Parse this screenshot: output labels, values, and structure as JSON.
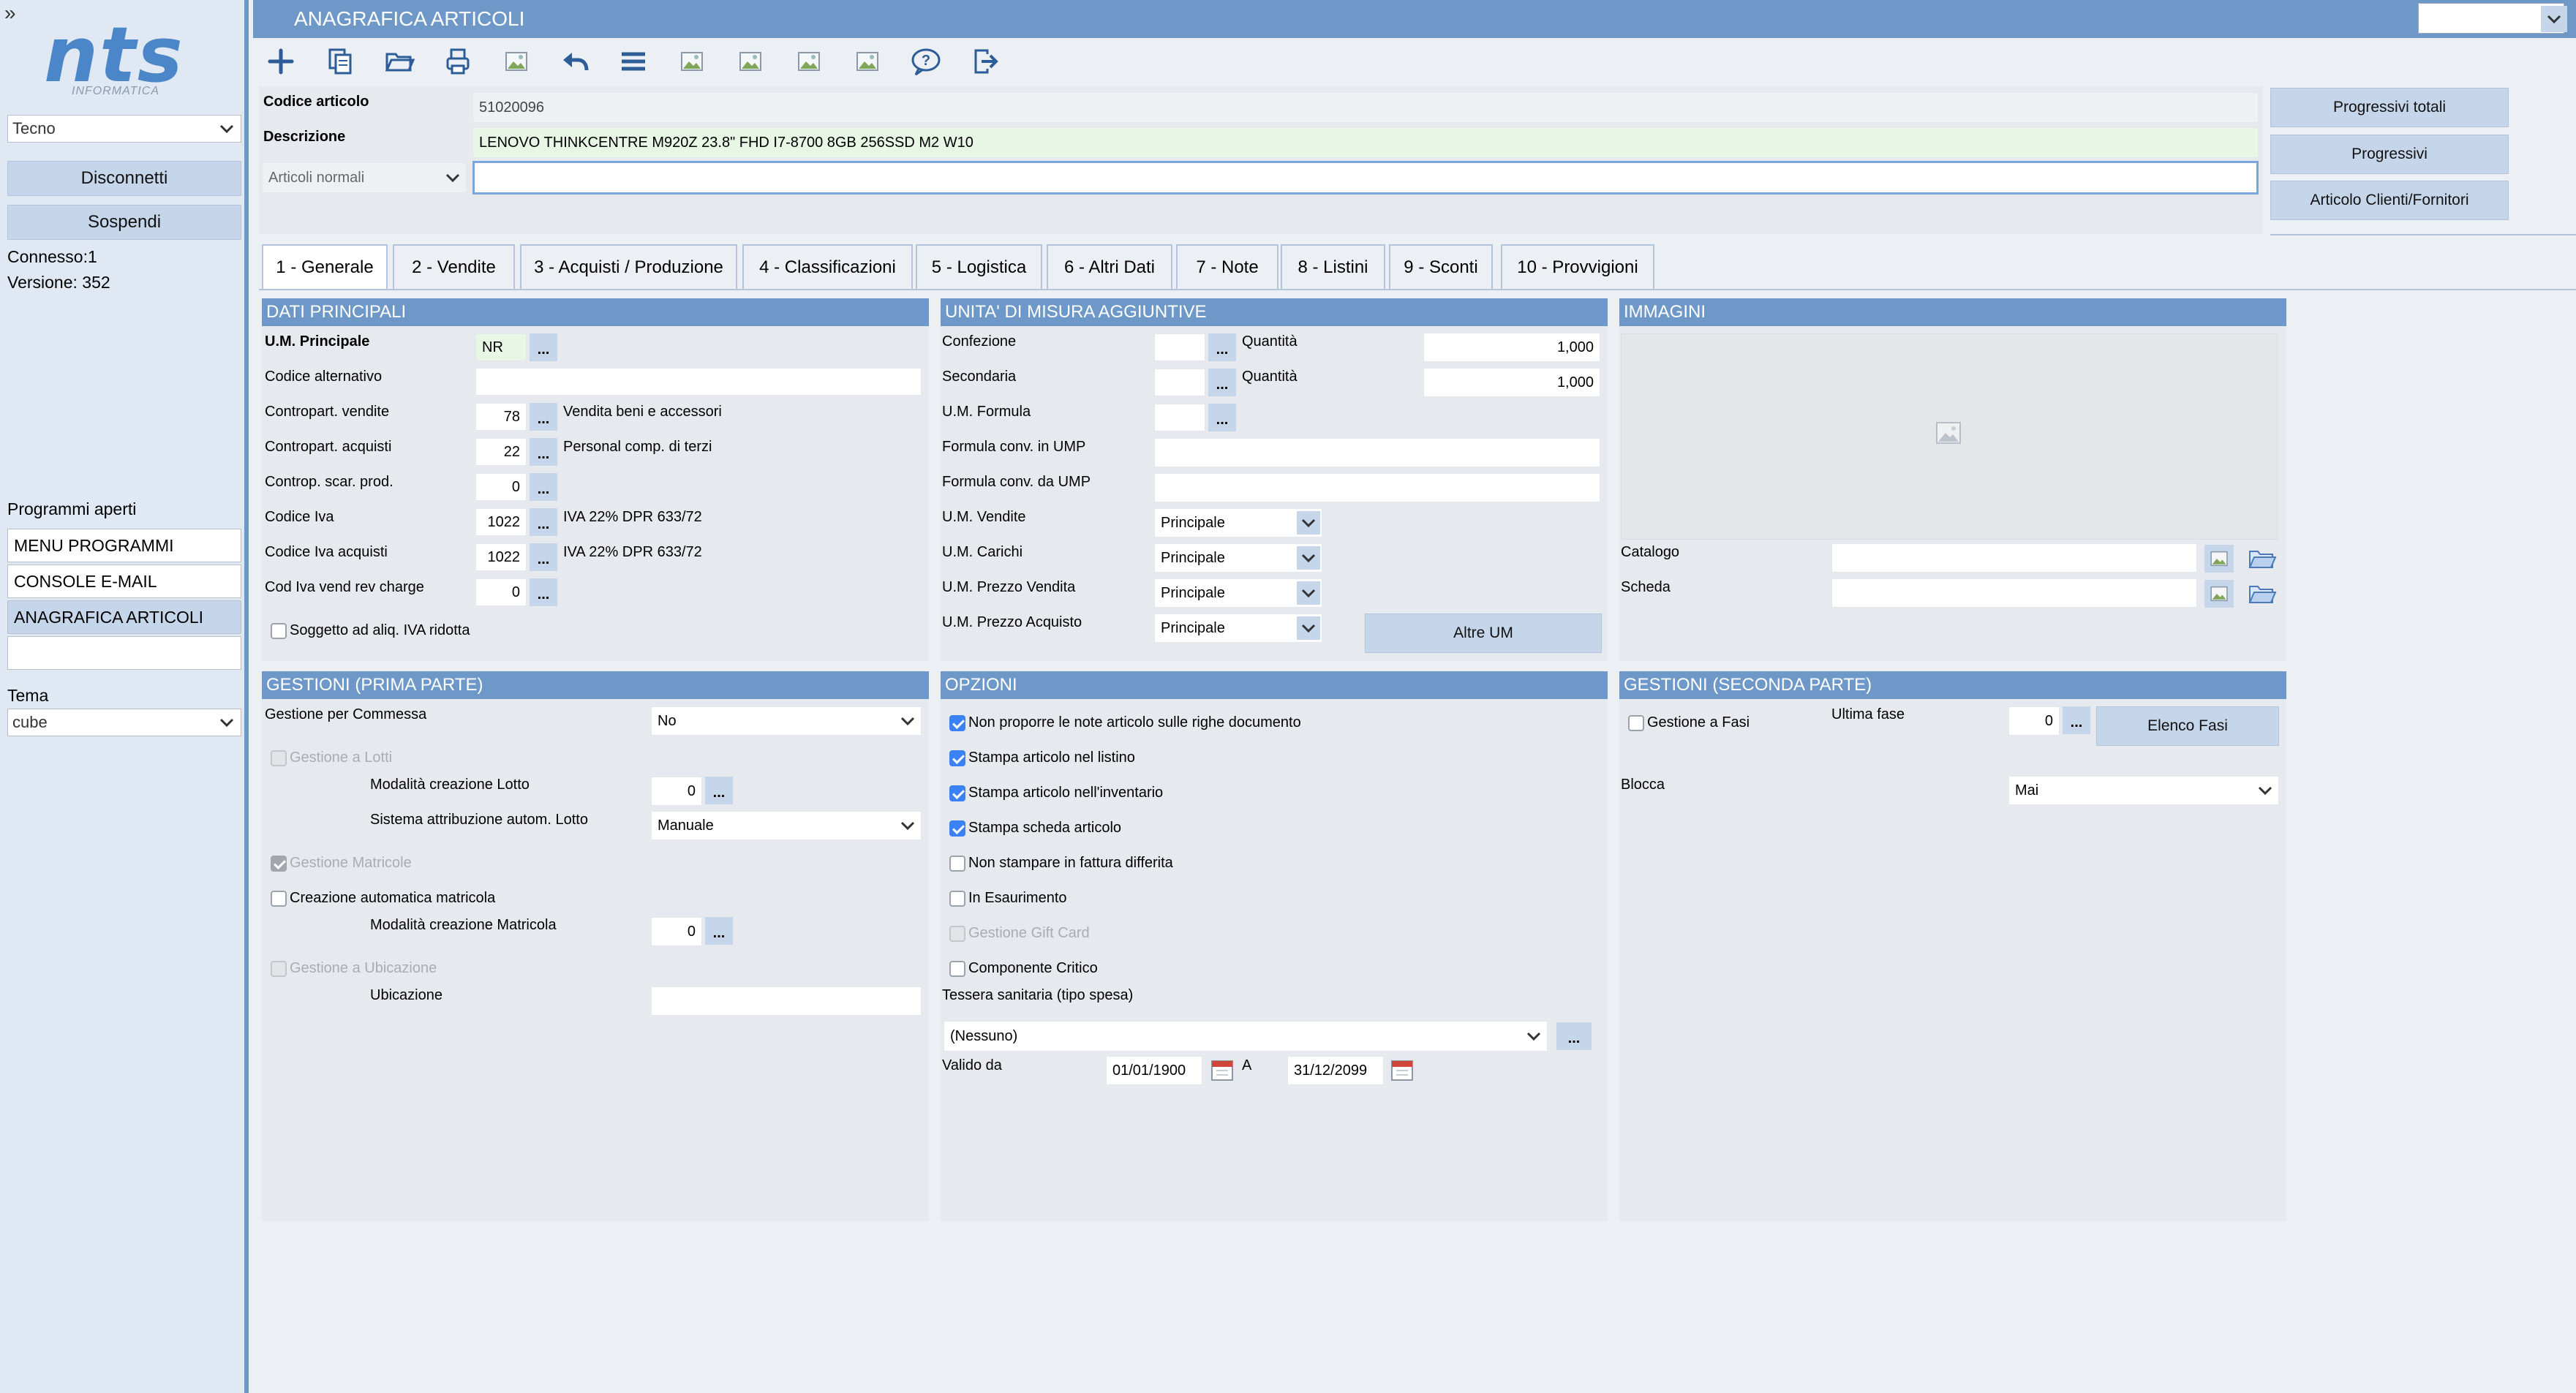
{
  "window": {
    "title": "ANAGRAFICA ARTICOLI",
    "expand_glyph": "»"
  },
  "sidebar": {
    "logo_text": "nts",
    "logo_sub": "INFORMATICA",
    "company_select": "Tecno",
    "disconnect_label": "Disconnetti",
    "suspend_label": "Sospendi",
    "connected": "Connesso:1",
    "version": "Versione: 352",
    "open_programs_title": "Programmi aperti",
    "programs": [
      "MENU PROGRAMMI",
      "CONSOLE E-MAIL",
      "ANAGRAFICA ARTICOLI",
      ""
    ],
    "theme_label": "Tema",
    "theme_value": "cube"
  },
  "toolbar": {
    "icons": [
      "plus-icon",
      "copy-icon",
      "open-folder-icon",
      "print-icon",
      "image-icon",
      "undo-icon",
      "menu-icon",
      "image-icon",
      "image-icon",
      "image-icon",
      "image-icon",
      "help-icon",
      "exit-icon"
    ]
  },
  "header": {
    "codice_label": "Codice articolo",
    "codice_value": "51020096",
    "descrizione_label": "Descrizione",
    "descrizione_value": "LENOVO THINKCENTRE M920Z 23.8\" FHD I7-8700 8GB 256SSD M2 W10",
    "tipo_select": "Articoli normali",
    "extra_desc_value": "",
    "btn_progressivi_totali": "Progressivi totali",
    "btn_progressivi": "Progressivi",
    "btn_articolo_clienti": "Articolo Clienti/Fornitori"
  },
  "tabs": [
    "1 - Generale",
    "2 - Vendite",
    "3 - Acquisti / Produzione",
    "4 - Classificazioni",
    "5 - Logistica",
    "6 - Altri Dati",
    "7 - Note",
    "8 - Listini",
    "9 - Sconti",
    "10 - Provvigioni"
  ],
  "dati_principali": {
    "title": "DATI PRINCIPALI",
    "um_principale_label": "U.M. Principale",
    "um_principale_value": "NR",
    "codice_alt_label": "Codice alternativo",
    "contro_vendite_label": "Contropart. vendite",
    "contro_vendite_value": "78",
    "contro_vendite_desc": "Vendita beni e accessori",
    "contro_acquisti_label": "Contropart. acquisti",
    "contro_acquisti_value": "22",
    "contro_acquisti_desc": "Personal comp. di terzi",
    "contro_scar_label": "Controp. scar. prod.",
    "contro_scar_value": "0",
    "codice_iva_label": "Codice Iva",
    "codice_iva_value": "1022",
    "codice_iva_desc": "IVA 22% DPR 633/72",
    "codice_iva_acq_label": "Codice Iva acquisti",
    "codice_iva_acq_value": "1022",
    "codice_iva_acq_desc": "IVA 22% DPR 633/72",
    "cod_iva_rev_label": "Cod Iva vend rev charge",
    "cod_iva_rev_value": "0",
    "soggetto_label": "Soggetto ad aliq. IVA ridotta",
    "dots": "..."
  },
  "unita_misura": {
    "title": "UNITA' DI MISURA AGGIUNTIVE",
    "confezione_label": "Confezione",
    "quantita_label": "Quantità",
    "quantita1_value": "1,000",
    "secondaria_label": "Secondaria",
    "quantita2_value": "1,000",
    "um_formula_label": "U.M. Formula",
    "formula_ump_label": "Formula conv. in UMP",
    "formula_da_ump_label": "Formula conv. da UMP",
    "um_vendite_label": "U.M. Vendite",
    "um_vendite_value": "Principale",
    "um_carichi_label": "U.M. Carichi",
    "um_carichi_value": "Principale",
    "um_prezzo_vendita_label": "U.M. Prezzo Vendita",
    "um_prezzo_vendita_value": "Principale",
    "um_prezzo_acquisto_label": "U.M. Prezzo Acquisto",
    "um_prezzo_acquisto_value": "Principale",
    "altre_um_label": "Altre UM"
  },
  "immagini": {
    "title": "IMMAGINI",
    "catalogo_label": "Catalogo",
    "scheda_label": "Scheda"
  },
  "gestioni_prima": {
    "title": "GESTIONI (PRIMA PARTE)",
    "commessa_label": "Gestione per Commessa",
    "commessa_value": "No",
    "lotti_label": "Gestione a Lotti",
    "mod_lotto_label": "Modalità creazione Lotto",
    "mod_lotto_value": "0",
    "sistema_lotto_label": "Sistema attribuzione autom. Lotto",
    "sistema_lotto_value": "Manuale",
    "matricole_label": "Gestione Matricole",
    "creazione_matricola_label": "Creazione automatica matricola",
    "mod_matricola_label": "Modalità creazione Matricola",
    "mod_matricola_value": "0",
    "ubicazione_check_label": "Gestione a Ubicazione",
    "ubicazione_label": "Ubicazione"
  },
  "opzioni": {
    "title": "OPZIONI",
    "items": [
      {
        "label": "Non proporre le note articolo sulle righe documento",
        "checked": true,
        "disabled": false
      },
      {
        "label": "Stampa articolo nel listino",
        "checked": true,
        "disabled": false
      },
      {
        "label": "Stampa articolo nell'inventario",
        "checked": true,
        "disabled": false
      },
      {
        "label": "Stampa scheda articolo",
        "checked": true,
        "disabled": false
      },
      {
        "label": "Non stampare in fattura differita",
        "checked": false,
        "disabled": false
      },
      {
        "label": "In Esaurimento",
        "checked": false,
        "disabled": false
      },
      {
        "label": "Gestione Gift Card",
        "checked": false,
        "disabled": true
      },
      {
        "label": "Componente Critico",
        "checked": false,
        "disabled": false
      }
    ],
    "tessera_label": "Tessera sanitaria (tipo spesa)",
    "tessera_value": "(Nessuno)",
    "valido_da_label": "Valido da",
    "valido_da_value": "01/01/1900",
    "a_label": "A",
    "a_value": "31/12/2099"
  },
  "gestioni_seconda": {
    "title": "GESTIONI (SECONDA PARTE)",
    "fasi_label": "Gestione a Fasi",
    "ultima_fase_label": "Ultima fase",
    "ultima_fase_value": "0",
    "elenco_fasi_label": "Elenco Fasi",
    "blocca_label": "Blocca",
    "blocca_value": "Mai"
  },
  "colors": {
    "accent": "#6e98c8",
    "button": "#c6d6ea",
    "panel": "#e6e9ee",
    "checkbox": "#3b82f6"
  }
}
